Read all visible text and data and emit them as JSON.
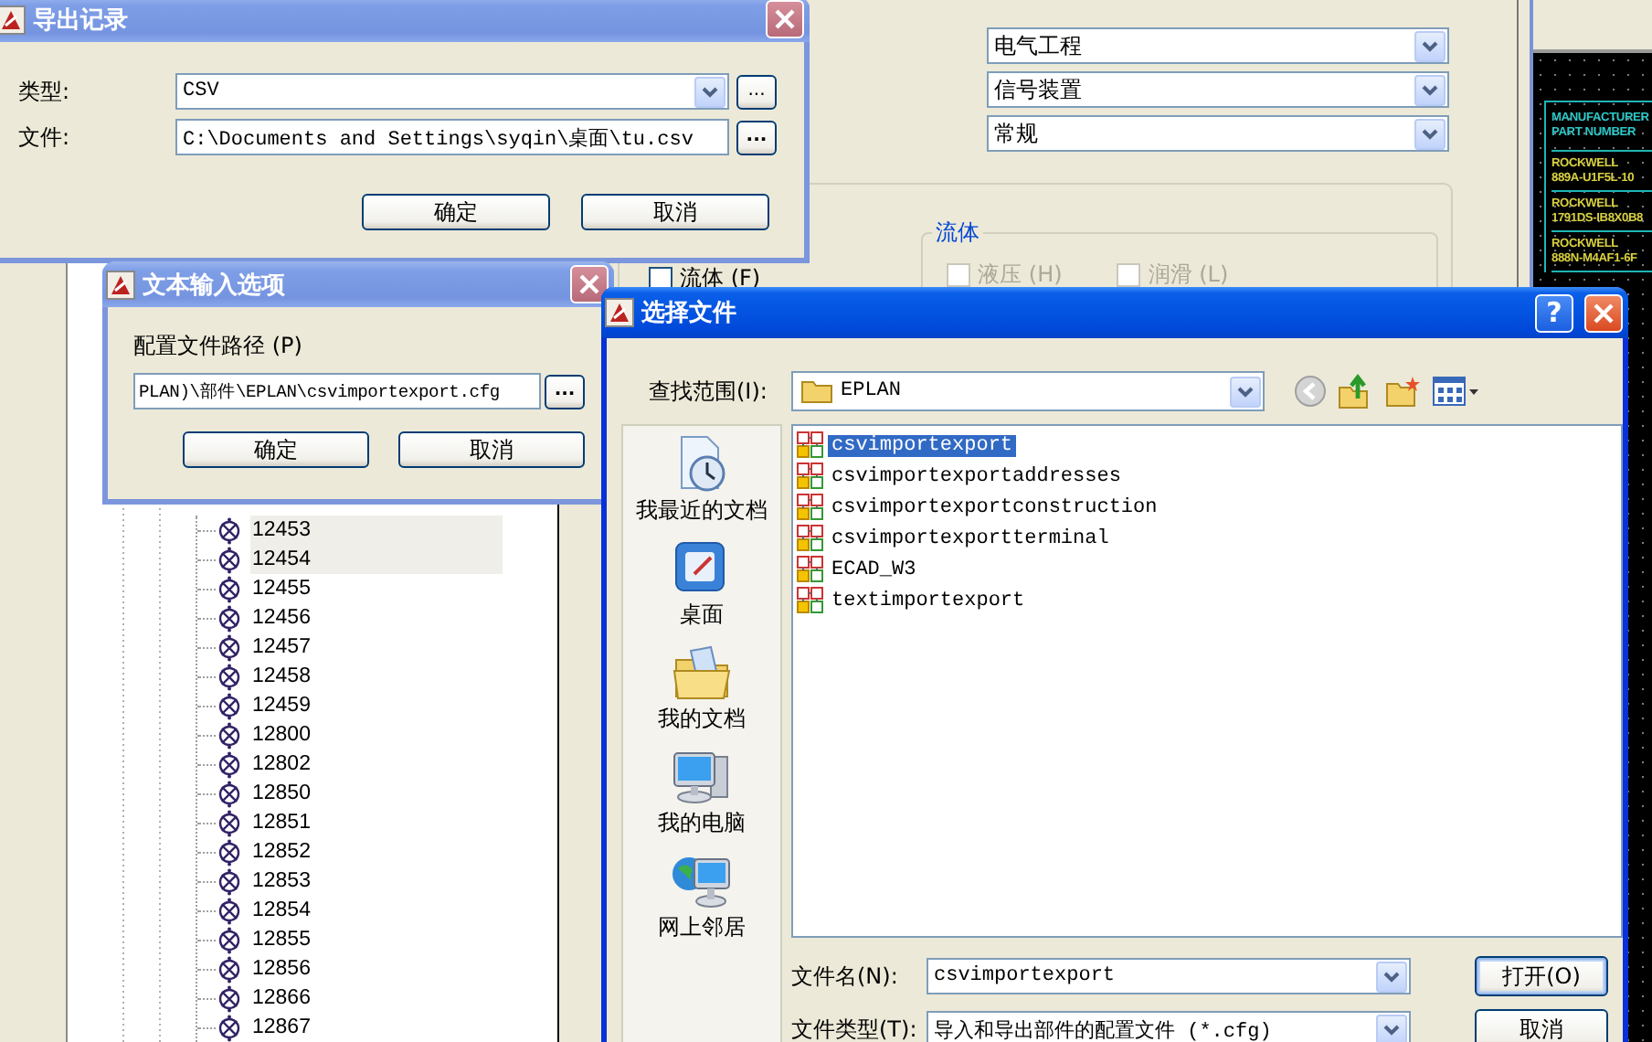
{
  "background_app": {
    "dropdowns": [
      {
        "value": "电气工程"
      },
      {
        "value": "信号装置"
      },
      {
        "value": "常规"
      }
    ],
    "fluid_checkbox": {
      "label": "流体 (F)",
      "checked": false
    },
    "fluid_group": {
      "title": "流体",
      "options": [
        {
          "label": "液压 (H)",
          "checked": false,
          "disabled": true
        },
        {
          "label": "润滑 (L)",
          "checked": false,
          "disabled": true
        }
      ]
    },
    "tree": {
      "items": [
        {
          "label": "12453",
          "selected": true
        },
        {
          "label": "12454",
          "selected": true
        },
        {
          "label": "12455",
          "selected": false
        },
        {
          "label": "12456",
          "selected": false
        },
        {
          "label": "12457",
          "selected": false
        },
        {
          "label": "12458",
          "selected": false
        },
        {
          "label": "12459",
          "selected": false
        },
        {
          "label": "12800",
          "selected": false
        },
        {
          "label": "12802",
          "selected": false
        },
        {
          "label": "12850",
          "selected": false
        },
        {
          "label": "12851",
          "selected": false
        },
        {
          "label": "12852",
          "selected": false
        },
        {
          "label": "12853",
          "selected": false
        },
        {
          "label": "12854",
          "selected": false
        },
        {
          "label": "12855",
          "selected": false
        },
        {
          "label": "12856",
          "selected": false
        },
        {
          "label": "12866",
          "selected": false
        },
        {
          "label": "12867",
          "selected": false
        }
      ]
    }
  },
  "cad_drawing": {
    "header": [
      "MANUFACTURER",
      "PART NUMBER"
    ],
    "rows": [
      {
        "manufacturer": "ROCKWELL",
        "part_number": "889A-U1F5L-10"
      },
      {
        "manufacturer": "ROCKWELL",
        "part_number": "1791DS-IB8X0B8"
      },
      {
        "manufacturer": "ROCKWELL",
        "part_number": "888N-M4AF1-6F"
      }
    ]
  },
  "export_dialog": {
    "title": "导出记录",
    "active": false,
    "type_label": "类型:",
    "type_value": "CSV",
    "type_browse": "...",
    "file_label": "文件:",
    "file_value": "C:\\Documents and Settings\\syqin\\桌面\\tu.csv",
    "file_browse": "...",
    "buttons": [
      "确定",
      "取消"
    ]
  },
  "text_input_dialog": {
    "title": "文本输入选项",
    "active": false,
    "path_label": "配置文件路径 (P)",
    "path_value": "PLAN)\\部件\\EPLAN\\csvimportexport.cfg",
    "browse": "...",
    "buttons": [
      "确定",
      "取消"
    ]
  },
  "file_dialog": {
    "title": "选择文件",
    "active": true,
    "help": "?",
    "look_in_label": "查找范围(I):",
    "look_in_value": "EPLAN",
    "places": [
      {
        "label": "我最近的文档",
        "kind": "recent"
      },
      {
        "label": "桌面",
        "kind": "desktop"
      },
      {
        "label": "我的文档",
        "kind": "documents"
      },
      {
        "label": "我的电脑",
        "kind": "computer"
      },
      {
        "label": "网上邻居",
        "kind": "network"
      }
    ],
    "files": [
      {
        "name": "csvimportexport",
        "selected": true
      },
      {
        "name": "csvimportexportaddresses",
        "selected": false
      },
      {
        "name": "csvimportexportconstruction",
        "selected": false
      },
      {
        "name": "csvimportexportterminal",
        "selected": false
      },
      {
        "name": "ECAD_W3",
        "selected": false
      },
      {
        "name": "textimportexport",
        "selected": false
      }
    ],
    "file_name_label": "文件名(N):",
    "file_name_value": "csvimportexport",
    "file_type_label": "文件类型(T):",
    "file_type_value": "导入和导出部件的配置文件 (*.cfg)",
    "buttons": [
      "打开(O)",
      "取消"
    ]
  }
}
